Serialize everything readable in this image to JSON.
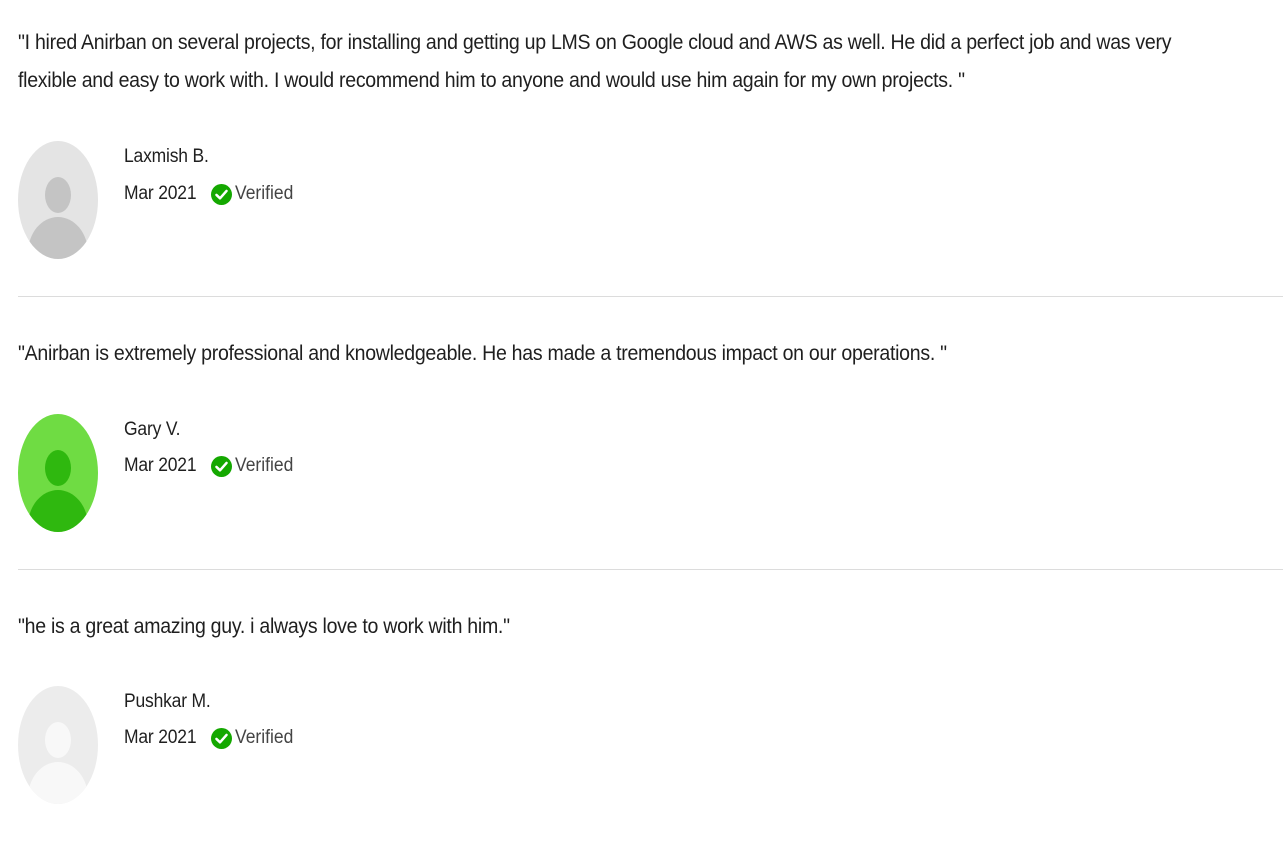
{
  "reviews": [
    {
      "quote": "\"I hired Anirban on several projects, for installing and getting up LMS on Google cloud and AWS as well. He did a perfect job and was very flexible and easy to work with. I would recommend him to anyone and would use him again for my own projects. \"",
      "reviewer": "Laxmish B.",
      "date": "Mar 2021",
      "verified_label": "Verified",
      "avatar_style": "grey"
    },
    {
      "quote": "\"Anirban is extremely professional and knowledgeable. He has made a tremendous impact on our operations. \"",
      "reviewer": "Gary V.",
      "date": "Mar 2021",
      "verified_label": "Verified",
      "avatar_style": "green"
    },
    {
      "quote": "\"he is a great amazing guy. i always love to work with him.\"",
      "reviewer": "Pushkar M.",
      "date": "Mar 2021",
      "verified_label": "Verified",
      "avatar_style": "light-grey"
    }
  ],
  "icons": {
    "verified": "check-circle-icon",
    "avatar": "user-avatar-icon"
  },
  "colors": {
    "verified_green": "#14a800",
    "avatar_grey_bg": "#e4e4e4",
    "avatar_grey_fg": "#c4c4c4",
    "avatar_green_bg": "#6fdc43",
    "avatar_green_fg": "#2fb80f",
    "avatar_light_bg": "#ececec",
    "avatar_light_fg": "#f8f8f8",
    "divider": "#dcdcdc"
  }
}
